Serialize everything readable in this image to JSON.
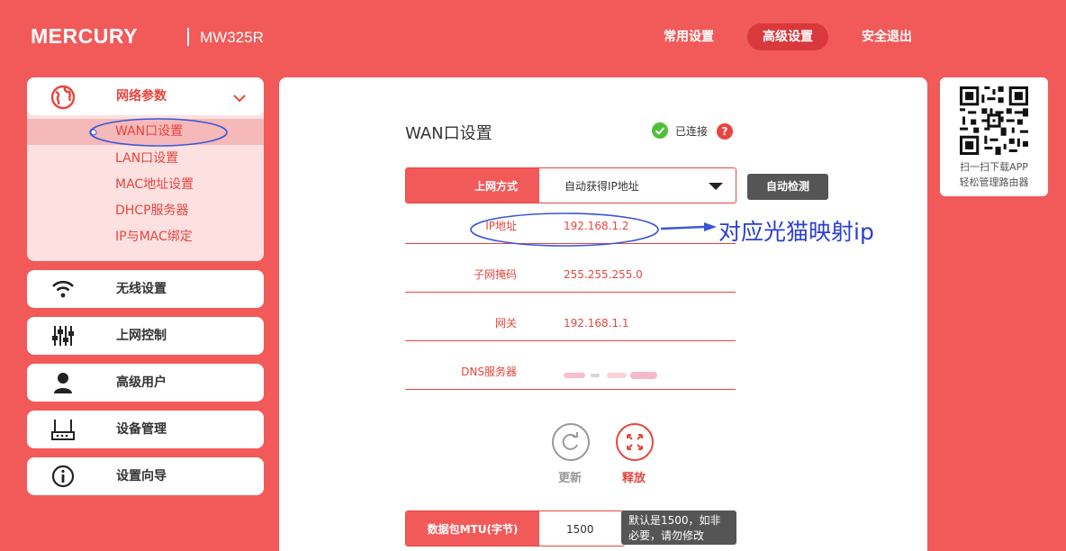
{
  "brand": {
    "logo": "MERCURY",
    "model": "MW325R"
  },
  "topnav": [
    {
      "label": "常用设置",
      "active": false
    },
    {
      "label": "高级设置",
      "active": true
    },
    {
      "label": "安全退出",
      "active": false
    }
  ],
  "sidebar": {
    "group": {
      "label": "网络参数",
      "icon": "globe-icon",
      "expanded": true,
      "items": [
        {
          "label": "WAN口设置",
          "active": true
        },
        {
          "label": "LAN口设置",
          "active": false
        },
        {
          "label": "MAC地址设置",
          "active": false
        },
        {
          "label": "DHCP服务器",
          "active": false
        },
        {
          "label": "IP与MAC绑定",
          "active": false
        }
      ]
    },
    "items": [
      {
        "label": "无线设置",
        "icon": "wifi-icon"
      },
      {
        "label": "上网控制",
        "icon": "sliders-icon"
      },
      {
        "label": "高级用户",
        "icon": "user-icon"
      },
      {
        "label": "设备管理",
        "icon": "router-icon"
      },
      {
        "label": "设置向导",
        "icon": "info-icon"
      }
    ]
  },
  "main": {
    "title": "WAN口设置",
    "status": "已连接",
    "help": "?",
    "mode": {
      "label": "上网方式",
      "value": "自动获得IP地址"
    },
    "detect_button": "自动检测",
    "rows": [
      {
        "key": "IP地址",
        "value": "192.168.1.2"
      },
      {
        "key": "子网掩码",
        "value": "255.255.255.0"
      },
      {
        "key": "网关",
        "value": "192.168.1.1"
      },
      {
        "key": "DNS服务器",
        "value": ""
      }
    ],
    "renew": "更新",
    "release": "释放",
    "mtu": {
      "label": "数据包MTU(字节)",
      "value": "1500",
      "hint_line1": "默认是1500，如非",
      "hint_line2": "必要，请勿修改"
    }
  },
  "qr": {
    "line1": "扫一扫下载APP",
    "line2": "轻松管理路由器"
  },
  "annotation": "对应光猫映射ip",
  "colors": {
    "bg": "#f25a5a",
    "accent": "#e8453e",
    "dark_red": "#d9393d",
    "annotation": "#2b3fd1",
    "ok": "#4fbf3a"
  }
}
